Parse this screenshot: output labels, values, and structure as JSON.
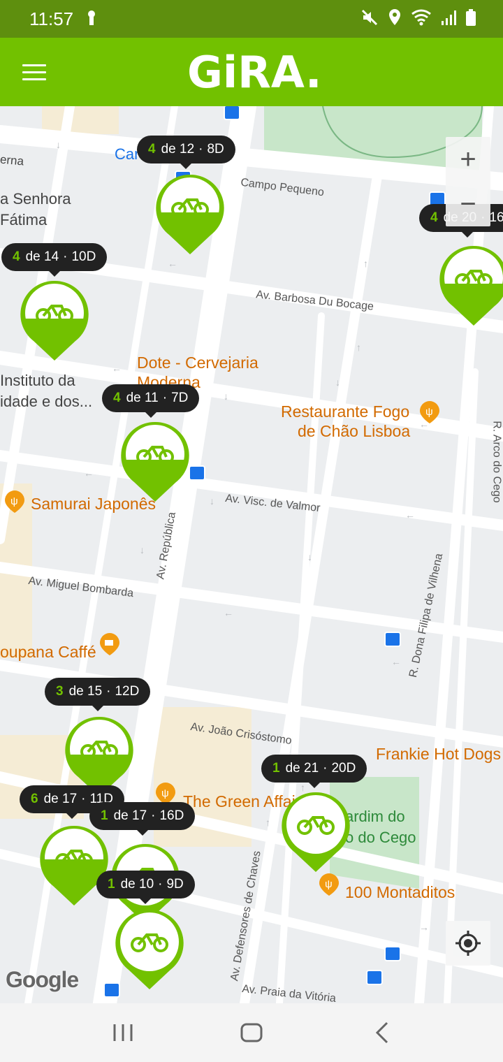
{
  "status_bar": {
    "time": "11:57"
  },
  "header": {
    "logo_text": "GiRA.",
    "brand_color": "#72c100",
    "status_color": "#5e8f0e"
  },
  "map": {
    "street_labels": {
      "campo_pequeno": "Campo Pequeno",
      "barbosa": "Av. Barbosa Du Bocage",
      "visc_valmor": "Av. Visc. de Valmor",
      "republica": "Av. República",
      "miguel_bombarda": "Av. Miguel Bombarda",
      "joao_crisostomo": "Av. João Crisóstomo",
      "dona_filipa": "R. Dona Filipa de Vilhena",
      "arco_cego": "R. Arco do Cego",
      "defensores": "Av. Defensores de Chaves",
      "praia_vitoria": "Av. Praia da Vitória",
      "erna": "erna",
      "car": "Car"
    },
    "place_labels": {
      "senhora_1": "a Senhora",
      "senhora_2": "Fátima",
      "instituto_1": "Instituto da",
      "instituto_2": "idade e dos...",
      "dote_1": "Dote - Cervejaria",
      "dote_2": "Moderna",
      "fogo_1": "Restaurante Fogo",
      "fogo_2": "de Chão Lisboa",
      "samurai": "Samurai Japonês",
      "cabana": "oupana Caffé",
      "frankie": "Frankie Hot Dogs",
      "green_affair": "The Green Affai",
      "jardim_1": "ardim do",
      "jardim_2": "o do Cego",
      "montaditos": "100 Montaditos"
    },
    "attribution": "Google"
  },
  "stations": [
    {
      "id": "a",
      "bikes": "4",
      "docks": "12",
      "free": "8D"
    },
    {
      "id": "b",
      "bikes": "4",
      "docks": "20",
      "free": "16"
    },
    {
      "id": "c",
      "bikes": "4",
      "docks": "14",
      "free": "10D"
    },
    {
      "id": "d",
      "bikes": "4",
      "docks": "11",
      "free": "7D"
    },
    {
      "id": "e",
      "bikes": "3",
      "docks": "15",
      "free": "12D"
    },
    {
      "id": "f",
      "bikes": "1",
      "docks": "21",
      "free": "20D"
    },
    {
      "id": "g",
      "bikes": "6",
      "docks": "17",
      "free": "11D"
    },
    {
      "id": "h",
      "bikes": "1",
      "docks": "17",
      "free": "16D"
    },
    {
      "id": "i",
      "bikes": "1",
      "docks": "10",
      "free": "9D"
    }
  ],
  "tip_words": {
    "of": "de",
    "dot": "·"
  },
  "controls": {
    "zoom_in": "+",
    "zoom_out": "−"
  }
}
